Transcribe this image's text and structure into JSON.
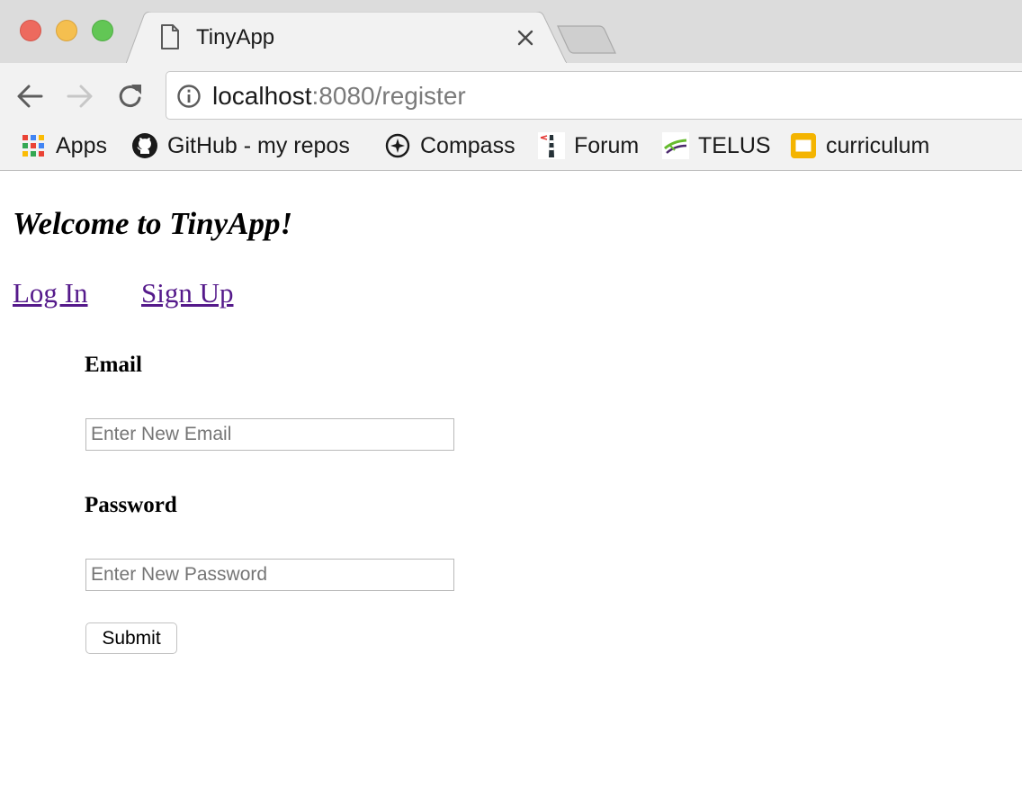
{
  "browser": {
    "tab": {
      "title": "TinyApp"
    },
    "address": {
      "host": "localhost",
      "path": ":8080/register"
    },
    "bookmarks": [
      {
        "label": "Apps",
        "icon": "apps-grid-icon"
      },
      {
        "label": "GitHub - my repos",
        "icon": "github-icon"
      },
      {
        "label": "Compass",
        "icon": "compass-icon"
      },
      {
        "label": "Forum",
        "icon": "lighthouse-icon"
      },
      {
        "label": "TELUS",
        "icon": "telus-icon"
      },
      {
        "label": "curriculum",
        "icon": "slides-icon"
      }
    ],
    "colors": {
      "close": "#ed6a5e",
      "minimize": "#f5bf4f",
      "maximize": "#62c655"
    }
  },
  "page": {
    "heading": "Welcome to TinyApp!",
    "nav": {
      "login": "Log In",
      "signup": "Sign Up"
    },
    "form": {
      "email_label": "Email",
      "email_placeholder": "Enter New Email",
      "password_label": "Password",
      "password_placeholder": "Enter New Password",
      "submit_label": "Submit"
    },
    "colors": {
      "link": "#551a8b"
    }
  }
}
